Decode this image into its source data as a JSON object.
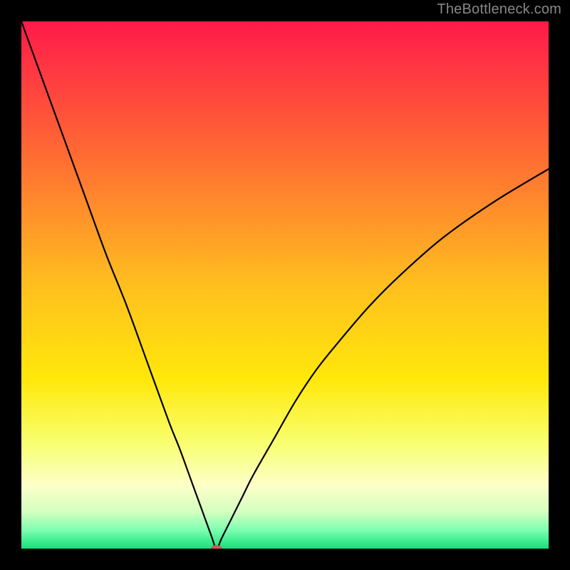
{
  "watermark": "TheBottleneck.com",
  "chart_data": {
    "type": "line",
    "title": "",
    "xlabel": "",
    "ylabel": "",
    "xlim": [
      0,
      100
    ],
    "ylim": [
      0,
      100
    ],
    "x": [
      0,
      4,
      8,
      12,
      16,
      20,
      24,
      28,
      30,
      32,
      34,
      36,
      37,
      38,
      40,
      42,
      44,
      48,
      52,
      56,
      60,
      66,
      72,
      80,
      90,
      100
    ],
    "y": [
      100,
      89,
      78,
      67,
      56,
      46,
      35,
      24,
      19,
      13.5,
      8,
      2.5,
      0,
      2,
      6,
      10,
      14,
      21,
      28,
      34,
      39,
      46,
      52,
      59,
      66,
      72
    ],
    "minimum_x": 37,
    "marker": {
      "x": 37,
      "y": 0
    },
    "background_gradient": {
      "stops": [
        {
          "offset": 0.0,
          "color": "#ff1a4a"
        },
        {
          "offset": 0.25,
          "color": "#ff6a33"
        },
        {
          "offset": 0.5,
          "color": "#ffbf1f"
        },
        {
          "offset": 0.68,
          "color": "#ffe80a"
        },
        {
          "offset": 0.8,
          "color": "#f8ff70"
        },
        {
          "offset": 0.88,
          "color": "#fdffc8"
        },
        {
          "offset": 0.93,
          "color": "#d4ffc0"
        },
        {
          "offset": 0.965,
          "color": "#7cffb0"
        },
        {
          "offset": 1.0,
          "color": "#14e07a"
        }
      ]
    },
    "curve_color": "#000000",
    "marker_color": "#cc5a5a"
  }
}
